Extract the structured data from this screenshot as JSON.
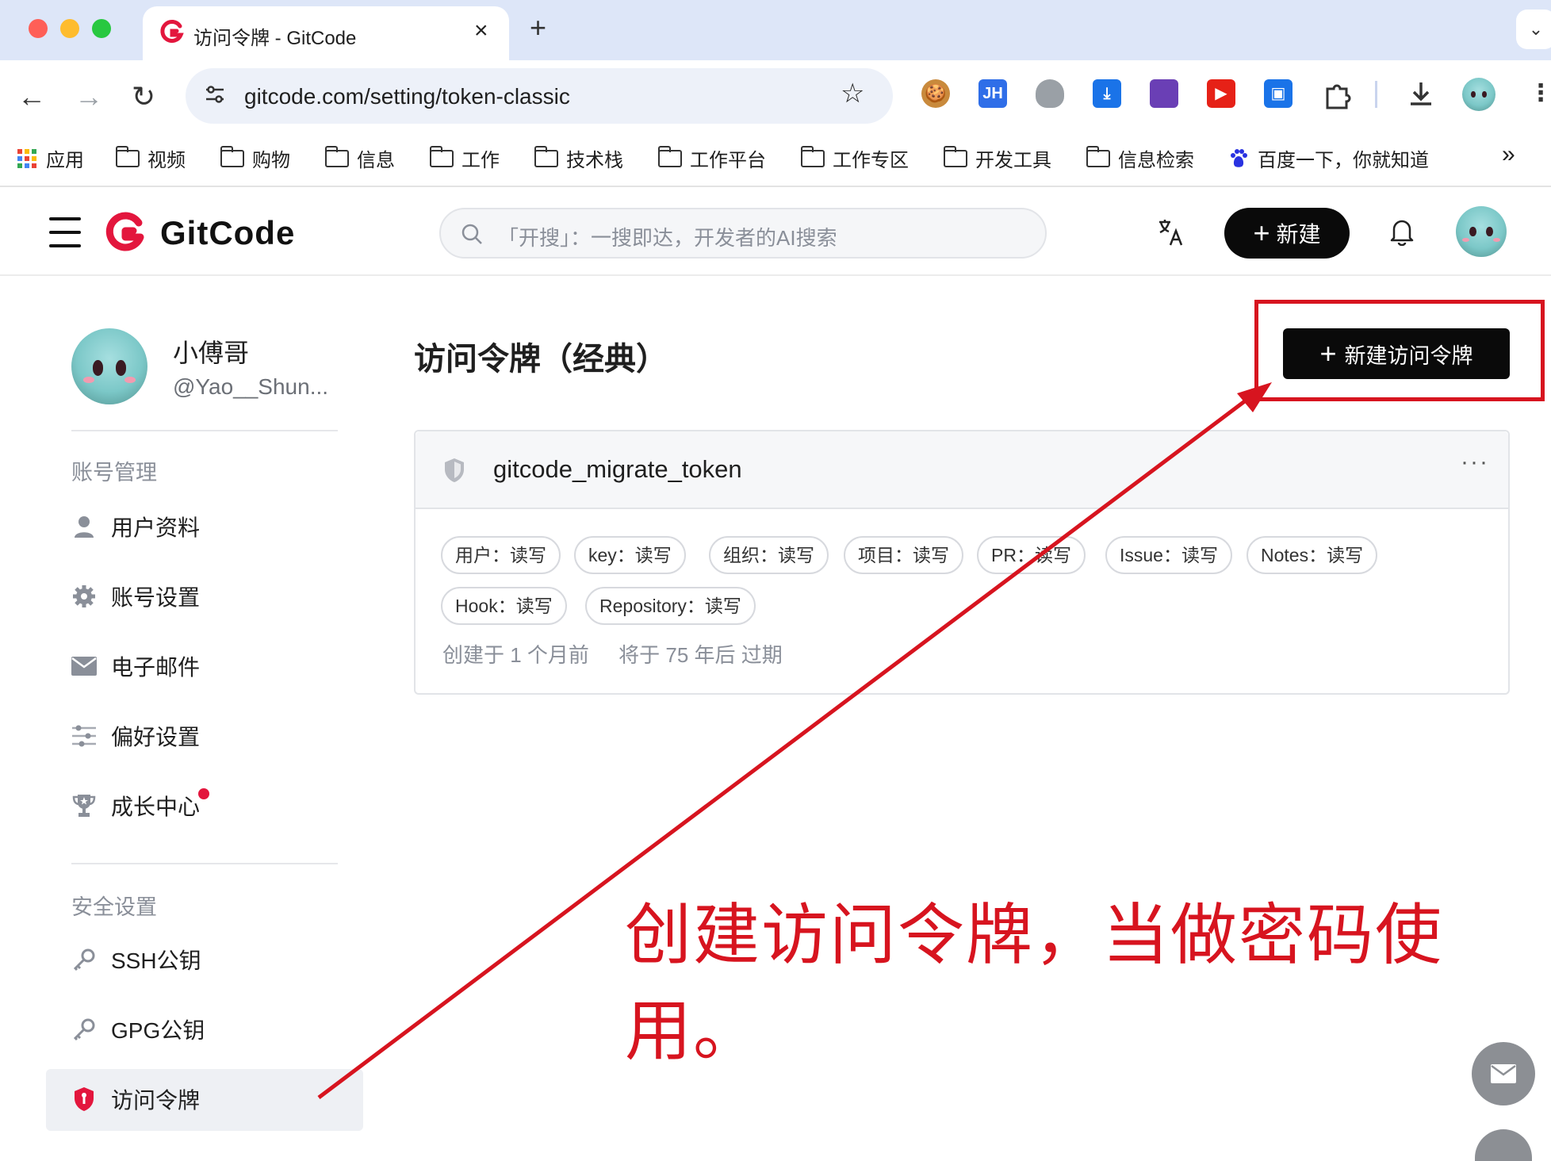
{
  "browser": {
    "tab": {
      "title": "访问令牌 - GitCode",
      "close": "×"
    },
    "new_tab": "+",
    "tab_menu": "⌄",
    "nav": {
      "back": "←",
      "forward": "→",
      "reload": "↻"
    },
    "url": "gitcode.com/setting/token-classic",
    "star": "☆",
    "bookmarks": [
      {
        "label": "应用",
        "icon": "apps-grid-icon"
      },
      {
        "label": "视频",
        "icon": "folder-icon"
      },
      {
        "label": "购物",
        "icon": "folder-icon"
      },
      {
        "label": "信息",
        "icon": "folder-icon"
      },
      {
        "label": "工作",
        "icon": "folder-icon"
      },
      {
        "label": "技术栈",
        "icon": "folder-icon"
      },
      {
        "label": "工作平台",
        "icon": "folder-icon"
      },
      {
        "label": "工作专区",
        "icon": "folder-icon"
      },
      {
        "label": "开发工具",
        "icon": "folder-icon"
      },
      {
        "label": "信息检索",
        "icon": "folder-icon"
      },
      {
        "label": "百度一下，你就知道",
        "icon": "baidu-paw-icon"
      }
    ],
    "bookmarks_more": "»",
    "extensions": [
      {
        "name": "cookie-extension-icon",
        "text": "🍪",
        "color": "#c98a3c"
      },
      {
        "name": "jh-extension-icon",
        "text": "JH",
        "color": "#2f6ee8"
      },
      {
        "name": "shield-extension-icon",
        "text": "",
        "color": "#9aa0a6"
      },
      {
        "name": "download-arrow-extension-icon",
        "text": "⤓",
        "color": "#1a73e8"
      },
      {
        "name": "colorful-extension-icon",
        "text": "",
        "color": "#6a3fb5"
      },
      {
        "name": "youtube-extension-icon",
        "text": "▶",
        "color": "#e62117"
      },
      {
        "name": "screen-extension-icon",
        "text": "▣",
        "color": "#1a73e8"
      }
    ]
  },
  "header": {
    "logo_text": "GitCode",
    "search_placeholder": "「开搜」：一搜即达，开发者的AI搜索",
    "new_button": "新建",
    "new_button_plus": "+"
  },
  "sidebar": {
    "profile": {
      "name": "小傅哥",
      "handle": "@Yao__Shun..."
    },
    "sections": [
      {
        "label": "账号管理",
        "items": [
          {
            "label": "用户资料",
            "icon": "user-icon"
          },
          {
            "label": "账号设置",
            "icon": "gear-icon"
          },
          {
            "label": "电子邮件",
            "icon": "mail-icon"
          },
          {
            "label": "偏好设置",
            "icon": "sliders-icon"
          },
          {
            "label": "成长中心",
            "icon": "trophy-icon"
          }
        ]
      },
      {
        "label": "安全设置",
        "items": [
          {
            "label": "SSH公钥",
            "icon": "key-icon"
          },
          {
            "label": "GPG公钥",
            "icon": "key-icon"
          },
          {
            "label": "访问令牌",
            "icon": "shield-icon",
            "active": true
          }
        ]
      }
    ]
  },
  "main": {
    "title": "访问令牌（经典）",
    "new_token_button": "新建访问令牌",
    "new_token_plus": "+",
    "token": {
      "name": "gitcode_migrate_token",
      "more": "···",
      "permissions": [
        "用户：读写",
        "key：读写",
        "组织：读写",
        "项目：读写",
        "PR：读写",
        "Issue：读写",
        "Notes：读写",
        "Hook：读写",
        "Repository：读写"
      ],
      "created": "创建于 1 个月前",
      "expires": "将于 75 年后 过期"
    }
  },
  "annotation": {
    "text": "创建访问令牌，当做密码使用。",
    "color": "#d7141f"
  },
  "colors": {
    "accent": "#0a0a0a",
    "brand_red": "#e3163d",
    "annotation_red": "#d7141f"
  }
}
